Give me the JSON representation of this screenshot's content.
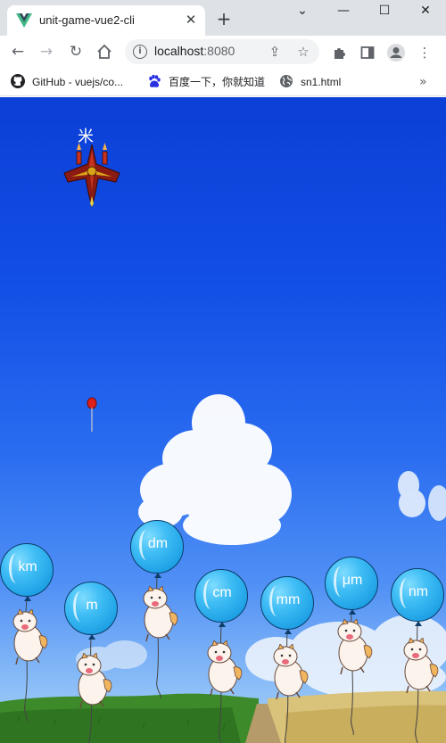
{
  "browser": {
    "tab_title": "unit-game-vue2-cli",
    "tab_close": "✕",
    "new_tab": "+",
    "url_host": "localhost",
    "url_port": ":8080",
    "window_controls": [
      "⌄",
      "—",
      "☐",
      "✕"
    ],
    "bookmarks": [
      {
        "label": "GitHub - vuejs/co...",
        "icon": "github-icon"
      },
      {
        "label": "百度一下，你就知道",
        "icon": "baidu-paw-icon"
      },
      {
        "label": "sn1.html",
        "icon": "globe-icon"
      }
    ],
    "bookmarks_more": "»"
  },
  "game": {
    "enemy_word": "米",
    "balloons": [
      {
        "label": "km"
      },
      {
        "label": "m"
      },
      {
        "label": "dm"
      },
      {
        "label": "cm"
      },
      {
        "label": "mm"
      },
      {
        "label": "μm"
      },
      {
        "label": "nm"
      }
    ]
  },
  "colors": {
    "sky_top": "#0b3fd6",
    "balloon": "#3fbdf5",
    "cloud": "#ffffff",
    "grass": "#3d8a2a",
    "wheat": "#d9c27a"
  }
}
